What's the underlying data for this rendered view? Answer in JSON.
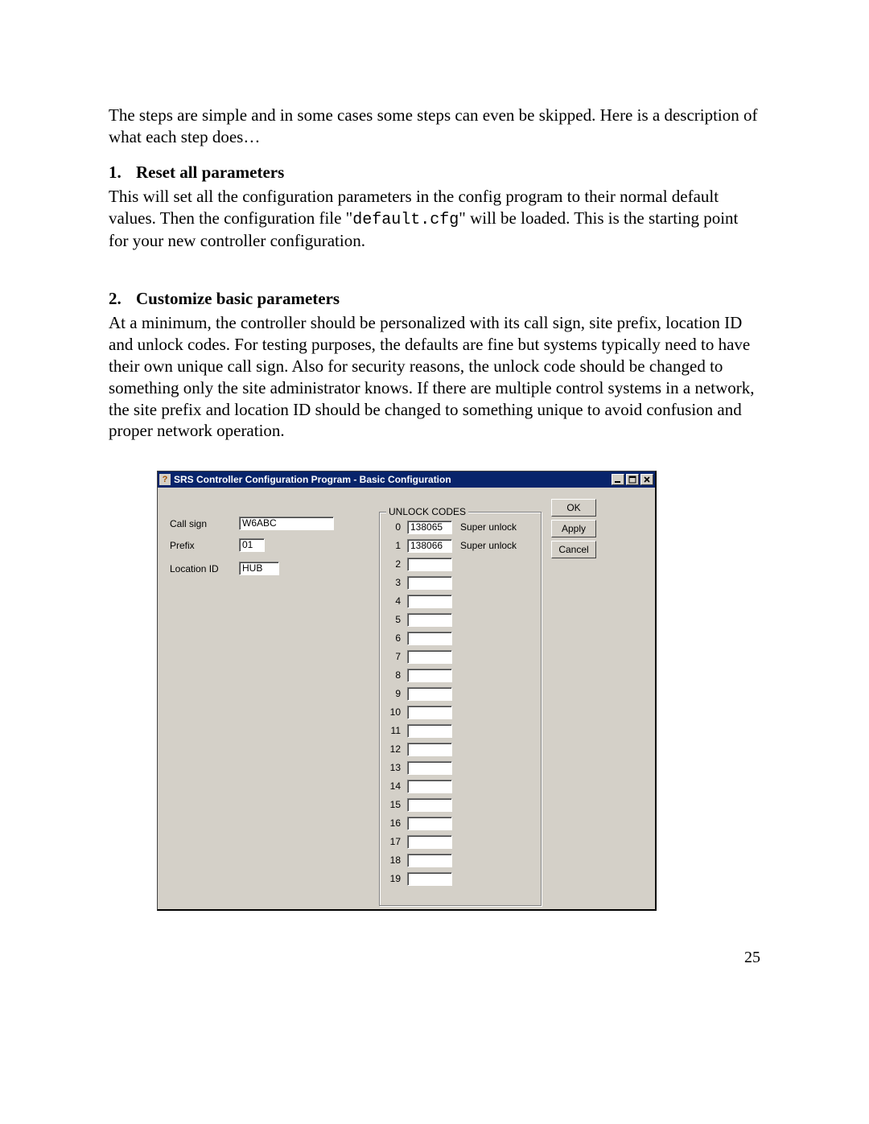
{
  "doc": {
    "intro": "The steps are simple and in some cases some steps can even be skipped.  Here is a description of what each step does…",
    "step1_num": "1.",
    "step1_title": "Reset all parameters",
    "step1_body_a": "This will set all the configuration parameters in the config program to their normal default values.  Then the configuration file \"",
    "step1_cfg": "default.cfg",
    "step1_body_b": "\" will be loaded.  This is the starting point for your new controller configuration.",
    "step2_num": "2.",
    "step2_title": "Customize basic parameters",
    "step2_body": "At a minimum, the controller should be personalized with its call sign, site prefix, location ID and unlock codes.  For testing purposes, the defaults are fine but systems typically need to have their own unique call sign.  Also for security reasons, the unlock code should be changed to something only the site administrator knows.  If there are multiple control systems in a network, the site prefix and location ID should be changed to something unique to avoid confusion and proper network operation.",
    "page_number": "25"
  },
  "win": {
    "title_icon": "?",
    "title": "SRS Controller Configuration Program - Basic Configuration",
    "labels": {
      "call_sign": "Call sign",
      "prefix": "Prefix",
      "location_id": "Location ID",
      "unlock_codes": "UNLOCK CODES"
    },
    "fields": {
      "call_sign": "W6ABC",
      "prefix": "01",
      "location_id": "HUB"
    },
    "buttons": {
      "ok": "OK",
      "apply": "Apply",
      "cancel": "Cancel"
    },
    "codes": [
      {
        "i": "0",
        "v": "138065",
        "d": "Super unlock"
      },
      {
        "i": "1",
        "v": "138066",
        "d": "Super unlock"
      },
      {
        "i": "2",
        "v": "",
        "d": ""
      },
      {
        "i": "3",
        "v": "",
        "d": ""
      },
      {
        "i": "4",
        "v": "",
        "d": ""
      },
      {
        "i": "5",
        "v": "",
        "d": ""
      },
      {
        "i": "6",
        "v": "",
        "d": ""
      },
      {
        "i": "7",
        "v": "",
        "d": ""
      },
      {
        "i": "8",
        "v": "",
        "d": ""
      },
      {
        "i": "9",
        "v": "",
        "d": ""
      },
      {
        "i": "10",
        "v": "",
        "d": ""
      },
      {
        "i": "11",
        "v": "",
        "d": ""
      },
      {
        "i": "12",
        "v": "",
        "d": ""
      },
      {
        "i": "13",
        "v": "",
        "d": ""
      },
      {
        "i": "14",
        "v": "",
        "d": ""
      },
      {
        "i": "15",
        "v": "",
        "d": ""
      },
      {
        "i": "16",
        "v": "",
        "d": ""
      },
      {
        "i": "17",
        "v": "",
        "d": ""
      },
      {
        "i": "18",
        "v": "",
        "d": ""
      },
      {
        "i": "19",
        "v": "",
        "d": ""
      }
    ]
  }
}
